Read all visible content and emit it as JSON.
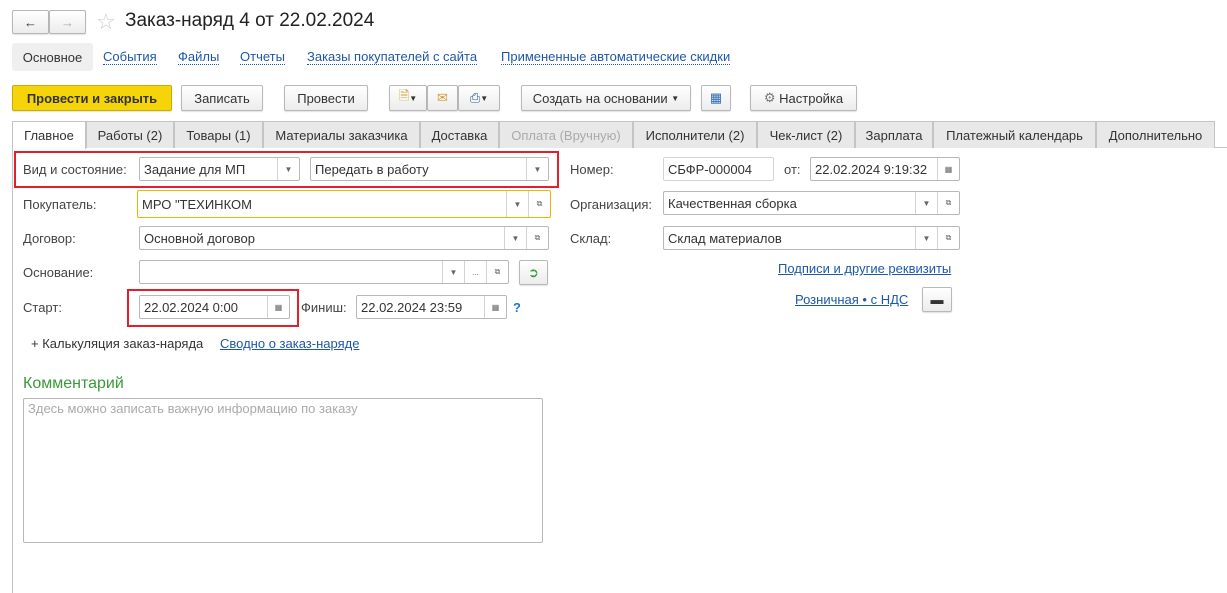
{
  "title": "Заказ-наряд 4 от 22.02.2024",
  "nav": [
    "Основное",
    "События",
    "Файлы",
    "Отчеты",
    "Заказы покупателей с сайта",
    "Примененные автоматические скидки"
  ],
  "toolbar": {
    "post_close": "Провести и закрыть",
    "save": "Записать",
    "post": "Провести",
    "create_based": "Создать на основании",
    "settings": "Настройка"
  },
  "tabs": [
    "Главное",
    "Работы (2)",
    "Товары (1)",
    "Материалы заказчика",
    "Доставка",
    "Оплата (Вручную)",
    "Исполнители (2)",
    "Чек-лист (2)",
    "Зарплата",
    "Платежный календарь",
    "Дополнительно"
  ],
  "form": {
    "kind_label": "Вид и состояние:",
    "kind": "Задание для МП",
    "state": "Передать в работу",
    "buyer_label": "Покупатель:",
    "buyer": "МРО \"ТЕХИНКОМ",
    "contract_label": "Договор:",
    "contract": "Основной договор",
    "basis_label": "Основание:",
    "basis": "",
    "start_label": "Старт:",
    "start": "22.02.2024  0:00",
    "finish_label": "Финиш:",
    "finish": "22.02.2024 23:59",
    "help": "?",
    "calc_link": "+ Калькуляция заказ-наряда",
    "summary_link": "Сводно о заказ-наряде",
    "number_label": "Номер:",
    "number": "СБФР-000004",
    "from_label": "от:",
    "date": "22.02.2024  9:19:32",
    "org_label": "Организация:",
    "org": "Качественная сборка",
    "warehouse_label": "Склад:",
    "warehouse": "Склад материалов",
    "signatures_link": "Подписи и другие реквизиты",
    "price_link": "Розничная • с НДС",
    "comment_title": "Комментарий",
    "comment_placeholder": "Здесь можно записать важную информацию по заказу"
  },
  "colors": {
    "primary_button": "#f5d50a",
    "link": "#1e58a8",
    "highlight": "#e0202a",
    "comment_title": "#3a9a3a"
  }
}
